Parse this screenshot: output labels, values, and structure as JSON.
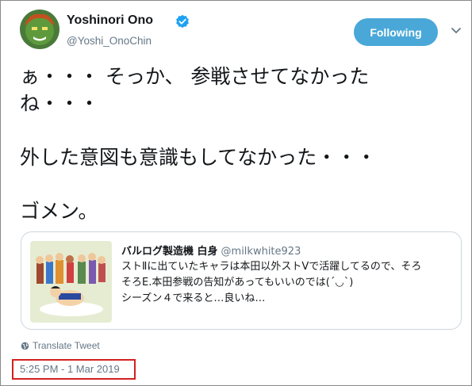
{
  "author": {
    "name": "Yoshinori Ono",
    "handle": "@Yoshi_OnoChin",
    "verified": true
  },
  "follow_button": {
    "label": "Following"
  },
  "icons": {
    "avatar": "blanka-avatar",
    "verified": "verified-badge-icon",
    "menu": "chevron-down-icon",
    "translate": "globe-icon"
  },
  "tweet": {
    "lines": [
      "ぁ・・・ そっか、 参戦させてなかった",
      "ね・・・",
      "",
      "外した意図も意識もしてなかった・・・",
      "",
      "ゴメン。"
    ]
  },
  "quoted_tweet": {
    "name": "バルログ製造機 白身",
    "handle": "@milkwhite923",
    "lines": [
      "ストⅡに出ていたキャラは本田以外ストⅤで活躍してるので、そろ",
      "そろE.本田参戦の告知があってもいいのでは(´◡`)",
      "シーズン４で来ると…良いね…"
    ]
  },
  "translate_label": "Translate Tweet",
  "timestamp": "5:25 PM - 1 Mar 2019",
  "colors": {
    "accent": "#4aa8d8",
    "verified": "#1da1f2",
    "highlight_box": "#d42020",
    "secondary_text": "#657786"
  }
}
